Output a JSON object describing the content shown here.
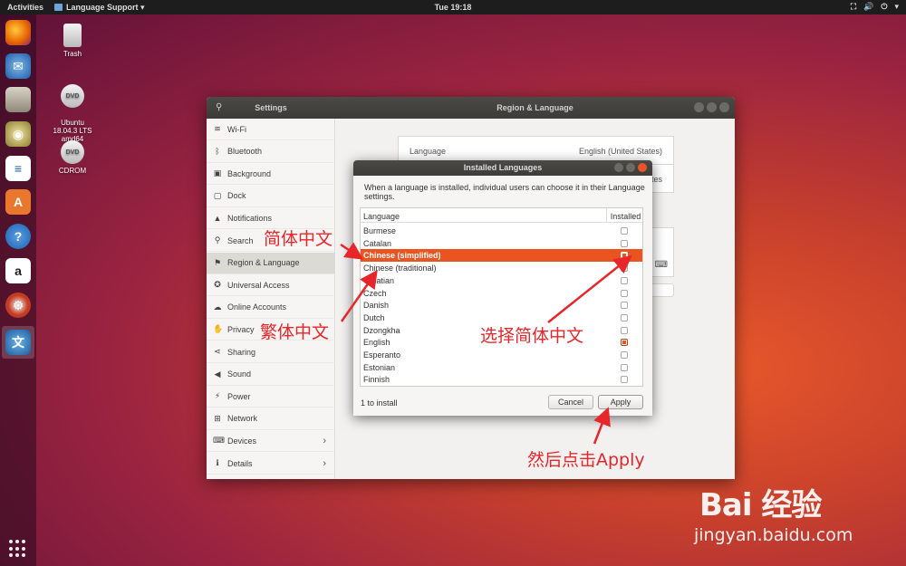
{
  "topbar": {
    "activities": "Activities",
    "app_menu": "Language Support ▾",
    "clock": "Tue 19:18",
    "tray": [
      "network-icon",
      "volume-icon",
      "power-icon"
    ]
  },
  "desktop": {
    "icons": [
      {
        "label": "Trash"
      },
      {
        "label": "Ubuntu\n18.04.3 LTS\namd64"
      },
      {
        "label": "CDROM"
      }
    ]
  },
  "dock": {
    "apps": [
      "firefox-icon",
      "thunderbird-icon",
      "files-icon",
      "rhythmbox-icon",
      "writer-icon",
      "software-icon",
      "help-icon",
      "amazon-icon",
      "settings-icon",
      "language-support-icon"
    ]
  },
  "settings": {
    "search_icon": "search-icon",
    "title": "Settings",
    "panel_title": "Region & Language",
    "sidebar": [
      {
        "label": "Wi-Fi",
        "icon": "wifi-icon"
      },
      {
        "label": "Bluetooth",
        "icon": "bluetooth-icon"
      },
      {
        "label": "Background",
        "icon": "background-icon"
      },
      {
        "label": "Dock",
        "icon": "dock-icon"
      },
      {
        "label": "Notifications",
        "icon": "bell-icon"
      },
      {
        "label": "Search",
        "icon": "search-icon"
      },
      {
        "label": "Region & Language",
        "icon": "flag-icon",
        "active": true
      },
      {
        "label": "Universal Access",
        "icon": "accessibility-icon"
      },
      {
        "label": "Online Accounts",
        "icon": "cloud-icon"
      },
      {
        "label": "Privacy",
        "icon": "privacy-icon"
      },
      {
        "label": "Sharing",
        "icon": "share-icon"
      },
      {
        "label": "Sound",
        "icon": "speaker-icon"
      },
      {
        "label": "Power",
        "icon": "power-icon"
      },
      {
        "label": "Network",
        "icon": "network-icon"
      },
      {
        "label": "Devices",
        "icon": "devices-icon",
        "chevron": true
      },
      {
        "label": "Details",
        "icon": "info-icon",
        "chevron": true
      }
    ],
    "region": {
      "language_label": "Language",
      "language_value": "English (United States)",
      "formats_value_partial": "tates"
    }
  },
  "dialog": {
    "title": "Installed Languages",
    "description": "When a language is installed, individual users can choose it in their Language settings.",
    "columns": {
      "language": "Language",
      "installed": "Installed"
    },
    "languages": [
      {
        "name": "Burmese",
        "installed": false
      },
      {
        "name": "Catalan",
        "installed": false
      },
      {
        "name": "Chinese (simplified)",
        "installed": true,
        "selected": true
      },
      {
        "name": "Chinese (traditional)",
        "installed": false
      },
      {
        "name": "Croatian",
        "installed": false
      },
      {
        "name": "Czech",
        "installed": false
      },
      {
        "name": "Danish",
        "installed": false
      },
      {
        "name": "Dutch",
        "installed": false
      },
      {
        "name": "Dzongkha",
        "installed": false
      },
      {
        "name": "English",
        "installed": true
      },
      {
        "name": "Esperanto",
        "installed": false
      },
      {
        "name": "Estonian",
        "installed": false
      },
      {
        "name": "Finnish",
        "installed": false
      }
    ],
    "status": "1 to install",
    "cancel": "Cancel",
    "apply": "Apply"
  },
  "annotations": {
    "simplified": "简体中文",
    "traditional": "繁体中文",
    "choose_simplified": "选择简体中文",
    "then_apply": "然后点击Apply",
    "color": "#e8262a"
  },
  "watermark": {
    "logo": "Bai 经验",
    "url": "jingyan.baidu.com"
  }
}
